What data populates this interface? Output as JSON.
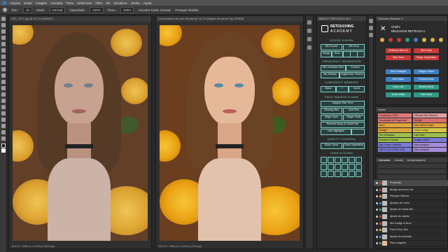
{
  "menu": [
    "Arquivo",
    "Editar",
    "Imagem",
    "Camada",
    "Texto",
    "Selecionar",
    "Filtro",
    "3D",
    "Visualizar",
    "Janela",
    "Ajuda"
  ],
  "options": {
    "size_label": "Tam.:",
    "size_value": "10",
    "mode_label": "Modo:",
    "mode_value": "Normal",
    "opacity_label": "Opacidade:",
    "opacity_value": "100%",
    "fluxo_label": "Fluxo:",
    "fluxo_value": "100%",
    "sample_all": "Amostra Todas Camad.",
    "protect_label": "Proteger detalhe"
  },
  "doc_left": {
    "tab": "HK1_7571.jpg @ 16,7% (RGB/8*)",
    "status": "16,67%",
    "status2": "1085 px x 1400 px (300 ppi)"
  },
  "doc_right": {
    "tab": "Dodonnation de pele DB.psd @ 16,7% (Ajuste de saída Clip, RGB/8)",
    "status": "16,67%",
    "status2": "1085 px x 1400 px (300 ppi)"
  },
  "retouching": {
    "header": "BEAUTY RETOUCH v2.1",
    "brand_top": "RETOUCHING",
    "brand_bottom": "ACADEMY",
    "sec_dodge": "DODGE & BURN",
    "btns_db": [
      "DB Curves",
      "DB Grey",
      "Dodge",
      "Burn"
    ],
    "sec_freq": "FREQUENCY SEPARATION",
    "btns_freq": [
      "Mix Gaussian Blur",
      "Custom",
      "Mix Median",
      "Digital Skin Texture"
    ],
    "sec_lum": "LUMINOSITY MASKING",
    "lum_btns": [
      "Basic",
      "+",
      "Invert"
    ],
    "sec_face": "FACE, MAKEUP & HAIR",
    "btns_face": [
      "Magical Skin Tone",
      "Glowing Skin",
      "Anti-Pink",
      "Magic Eyes",
      "Magic Smile",
      "Remove Body & Facial Hair",
      "Hair Highlights"
    ],
    "sec_qc": "QUALITY CONTROL",
    "btns_qc": [
      "Solar Curve",
      "Clear Separation"
    ],
    "sec_user": "USER ACTIONS"
  },
  "rbr": {
    "header": "Delicious Retouch 4",
    "logo_line1": "Chef's",
    "logo_line2": "DELICIOUS RETOUCH 4",
    "buttons": [
      {
        "label": "Delicious Skin v4",
        "color": "#c73b39"
      },
      {
        "label": "Skin Glow",
        "color": "#c73b39"
      },
      {
        "label": "Skin Tone",
        "color": "#c73b39"
      },
      {
        "label": "Frequ. Separation",
        "color": "#c73b39"
      },
      {
        "label": "Skin Changes",
        "color": "#3e7ec0"
      },
      {
        "label": "Dodge & Burn",
        "color": "#3e7ec0"
      },
      {
        "label": "Skin Mask",
        "color": "#3e7ec0"
      },
      {
        "label": "Portrait Mode",
        "color": "#3e7ec0"
      },
      {
        "label": "Eyes Lab",
        "color": "#2f9a87"
      },
      {
        "label": "Beauty Burst",
        "color": "#2f9a87"
      },
      {
        "label": "Teeth White",
        "color": "#2f9a87"
      },
      {
        "label": "Hair Tools",
        "color": "#2f9a87"
      }
    ]
  },
  "actions": {
    "header": "Ações",
    "rows": [
      {
        "left": "Frequency 2 D/B +",
        "right": "Ultimate Skin Retouch",
        "lc": "#e07a7a",
        "rc": "#e1a0a0"
      },
      {
        "left": "Separação de Frequência",
        "right": "DoDg4",
        "lc": "#e07a7a",
        "rc": "#d86f6f"
      },
      {
        "left": "Burn*",
        "right": "Mac Teeth & Eyes",
        "lc": "#e0a43a",
        "rc": "#e0a43a"
      },
      {
        "left": "Dodge*",
        "right": "Color Lookup",
        "lc": "#e0a43a",
        "rc": "#d7c748"
      },
      {
        "left": "Pin & Shadow",
        "right": "Lab Color",
        "lc": "#9dbf4a",
        "rc": "#9dbf4a"
      },
      {
        "left": "Enhance Portraits",
        "right": "Dodge & Burn",
        "lc": "#9dbf4a",
        "rc": "#7a7ad6"
      },
      {
        "left": "Ajs 2 Layer Lowered",
        "right": "New compact",
        "lc": "#7a7ad6",
        "rc": "#a78ad8"
      },
      {
        "left": "WP GLI ACTIONS 2015",
        "right": "New compact",
        "lc": "#7a7ad6",
        "rc": "#a78ad8"
      }
    ]
  },
  "layers": {
    "tabs": [
      "Camadas",
      "Canais",
      "Demarcadores"
    ],
    "items": [
      {
        "name": "Produção",
        "color": "#5a5a5a"
      },
      {
        "name": "Bridge and burn set",
        "color": "#5a5a5a"
      },
      {
        "name": "Retoque Beleza",
        "color": "#5a5a5a"
      },
      {
        "name": "Ajustes de cores",
        "color": "#5a5a5a"
      },
      {
        "name": "Ajuste de saída Mix",
        "color": "#5a5a5a"
      },
      {
        "name": "Ajuste de cabelo",
        "color": "#5a5a5a"
      },
      {
        "name": "Mix Dodge & Burn",
        "color": "#5a5a5a"
      },
      {
        "name": "Fund Freq. Box",
        "color": "#5a5a5a"
      },
      {
        "name": "Ajuste de emulsão",
        "color": "#5a5a5a"
      },
      {
        "name": "Plan ninguém",
        "color": "#5a5a5a"
      }
    ],
    "dot_colors": [
      "#c73b39",
      "#c73b39",
      "#d7a030",
      "#3e7ec0",
      "#2f9a87",
      "#c73b39",
      "#c73b39",
      "#d7a030",
      "#3e7ec0",
      "#2f9a87"
    ]
  }
}
